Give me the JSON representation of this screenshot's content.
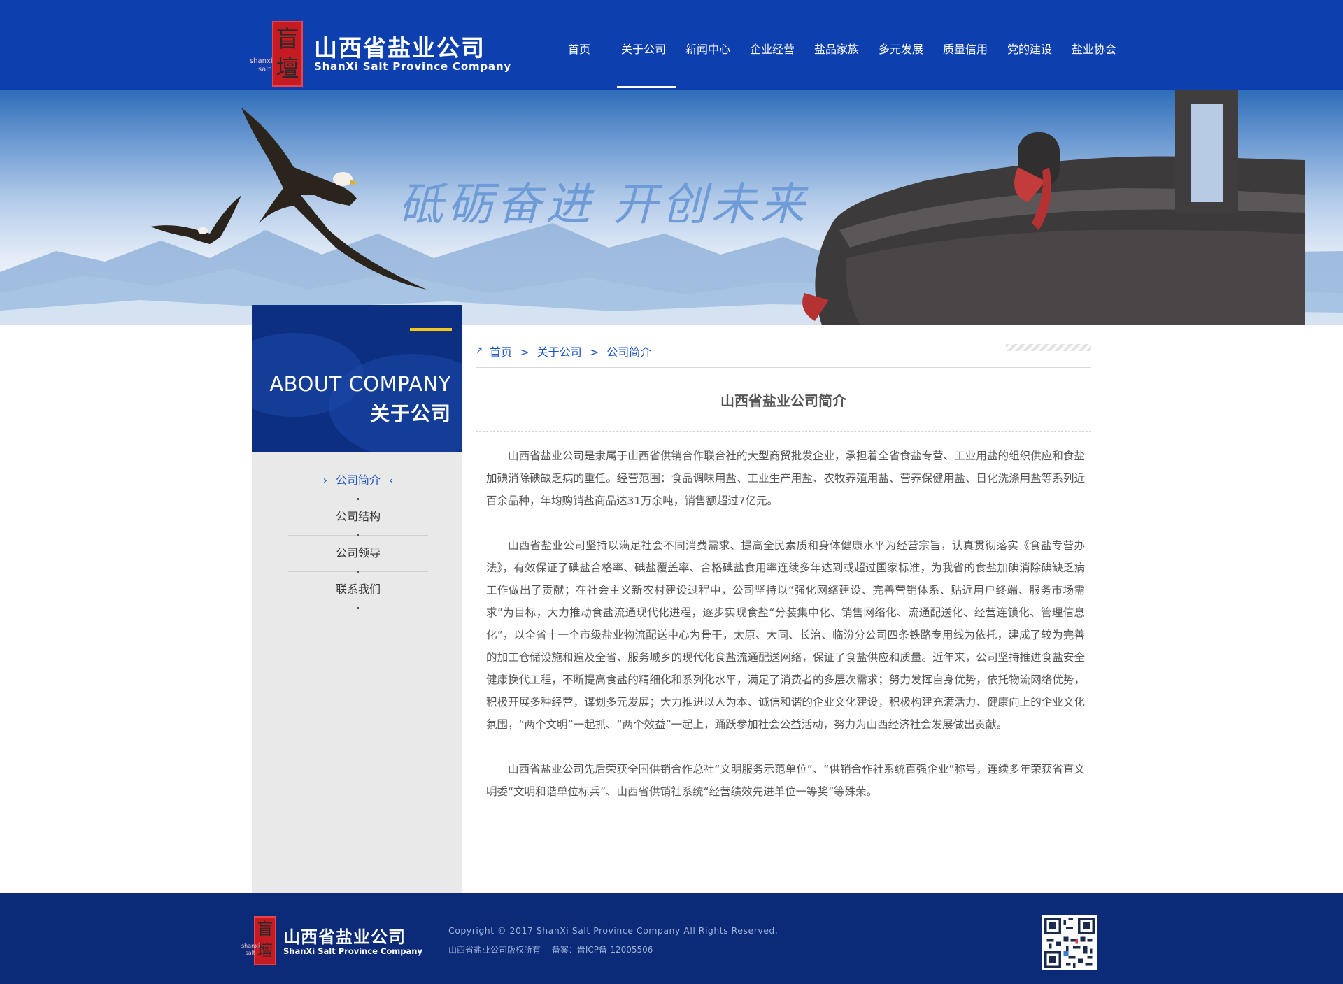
{
  "header": {
    "logo_seal_chars": [
      "盲",
      "壇"
    ],
    "logo_seal_small": "shanxi salt",
    "logo_cn": "山西省盐业公司",
    "logo_en": "ShanXi Salt Province Company",
    "nav": [
      "首页",
      "关于公司",
      "新闻中心",
      "企业经营",
      "盐品家族",
      "多元发展",
      "质量信用",
      "党的建设",
      "盐业协会"
    ],
    "active_nav": "关于公司"
  },
  "banner": {
    "slogan": "砥砺奋进  开创未来"
  },
  "sidebar": {
    "title_en": "ABOUT COMPANY",
    "title_cn": "关于公司",
    "items": [
      "公司简介",
      "公司结构",
      "公司领导",
      "联系我们"
    ],
    "active_item": "公司简介"
  },
  "breadcrumb": {
    "items": [
      "首页",
      "关于公司",
      "公司简介"
    ],
    "separator": ">"
  },
  "article": {
    "title": "山西省盐业公司简介",
    "paragraphs": [
      "山西省盐业公司是隶属于山西省供销合作联合社的大型商贸批发企业，承担着全省食盐专营、工业用盐的组织供应和食盐加碘消除碘缺乏病的重任。经营范围：食品调味用盐、工业生产用盐、农牧养殖用盐、营养保健用盐、日化洗涤用盐等系列近百余品种，年均购销盐商品达31万余吨，销售额超过7亿元。",
      "山西省盐业公司坚持以满足社会不同消费需求、提高全民素质和身体健康水平为经营宗旨，认真贯彻落实《食盐专营办法》，有效保证了碘盐合格率、碘盐覆盖率、合格碘盐食用率连续多年达到或超过国家标准，为我省的食盐加碘消除碘缺乏病工作做出了贡献；在社会主义新农村建设过程中，公司坚持以“强化网络建设、完善营销体系、贴近用户终端、服务市场需求”为目标，大力推动食盐流通现代化进程，逐步实现食盐“分装集中化、销售网络化、流通配送化、经营连锁化、管理信息化”，以全省十一个市级盐业物流配送中心为骨干，太原、大同、长治、临汾分公司四条铁路专用线为依托，建成了较为完善的加工仓储设施和遍及全省、服务城乡的现代化食盐流通配送网络，保证了食盐供应和质量。近年来，公司坚持推进食盐安全健康换代工程，不断提高食盐的精细化和系列化水平，满足了消费者的多层次需求；努力发挥自身优势，依托物流网络优势，积极开展多种经营，谋划多元发展；大力推进以人为本、诚信和谐的企业文化建设，积极构建充满活力、健康向上的企业文化氛围，“两个文明”一起抓、“两个效益”一起上，踊跃参加社会公益活动，努力为山西经济社会发展做出贡献。",
      "山西省盐业公司先后荣获全国供销合作总社“文明服务示范单位”、“供销合作社系统百强企业”称号，连续多年荣获省直文明委“文明和谐单位标兵”、山西省供销社系统“经营绩效先进单位一等奖”等殊荣。"
    ]
  },
  "footer": {
    "logo_cn": "山西省盐业公司",
    "logo_en": "ShanXi Salt Province Company",
    "copyright": "Copyright © 2017 ShanXi Salt Province Company All Rights Reserved.",
    "rights": "山西省盐业公司版权所有",
    "icp": "备案：晋ICP备-12005506"
  },
  "colors": {
    "brand_blue": "#0d3fae",
    "footer_blue": "#0b2a78",
    "accent_yellow": "#f2c61a",
    "link_blue": "#1e53c8",
    "seal_red": "#c61b23"
  }
}
